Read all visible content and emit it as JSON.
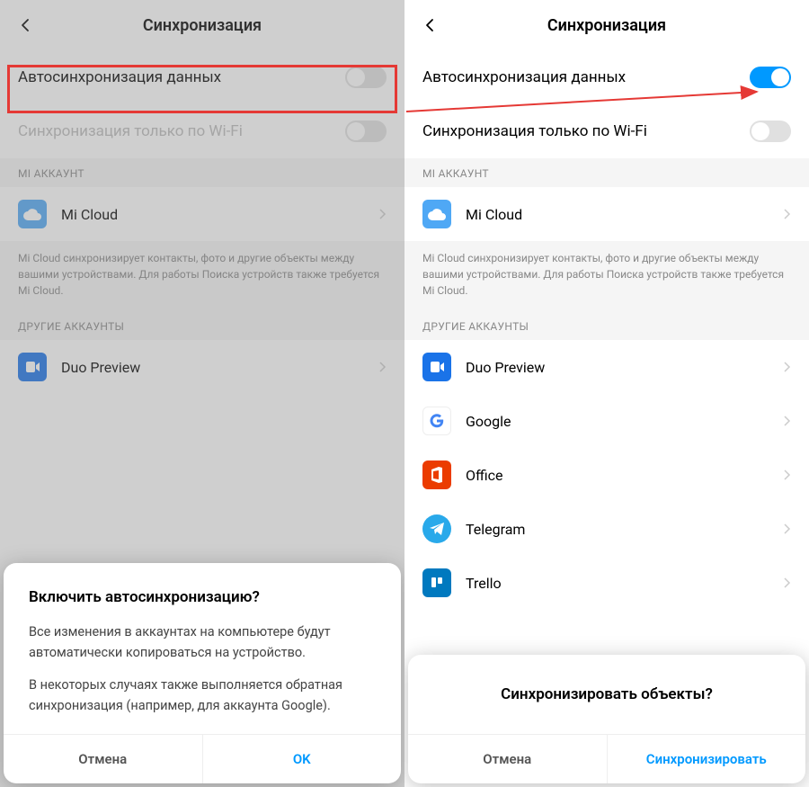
{
  "left": {
    "header": {
      "title": "Синхронизация"
    },
    "autosync": {
      "label": "Автосинхронизация данных",
      "enabled": false
    },
    "wifi_only": {
      "label": "Синхронизация только по Wi-Fi",
      "enabled": false
    },
    "sections": {
      "mi_account": "MI АККАУНТ",
      "mi_cloud_desc": "Mi Cloud синхронизирует контакты, фото и другие объекты между вашими устройствами. Для работы Поиска устройств также требуется Mi Cloud.",
      "other_accounts": "ДРУГИЕ АККАУНТЫ"
    },
    "apps": {
      "micloud": "Mi Cloud",
      "duo": "Duo Preview"
    },
    "dialog": {
      "title": "Включить автосинхронизацию?",
      "p1": "Все изменения в аккаунтах на компьютере будут автоматически копироваться на устройство.",
      "p2": "В некоторых случаях также выполняется обратная синхронизация (например, для аккаунта Google).",
      "cancel": "Отмена",
      "ok": "OK"
    }
  },
  "right": {
    "header": {
      "title": "Синхронизация"
    },
    "autosync": {
      "label": "Автосинхронизация данных",
      "enabled": true
    },
    "wifi_only": {
      "label": "Синхронизация только по Wi-Fi",
      "enabled": false
    },
    "sections": {
      "mi_account": "MI АККАУНТ",
      "mi_cloud_desc": "Mi Cloud синхронизирует контакты, фото и другие объекты между вашими устройствами. Для работы Поиска устройств также требуется Mi Cloud.",
      "other_accounts": "ДРУГИЕ АККАУНТЫ"
    },
    "apps": {
      "micloud": "Mi Cloud",
      "duo": "Duo Preview",
      "google": "Google",
      "office": "Office",
      "telegram": "Telegram",
      "trello": "Trello"
    },
    "dialog": {
      "title": "Синхронизировать объекты?",
      "cancel": "Отмена",
      "confirm": "Синхронизировать"
    }
  }
}
